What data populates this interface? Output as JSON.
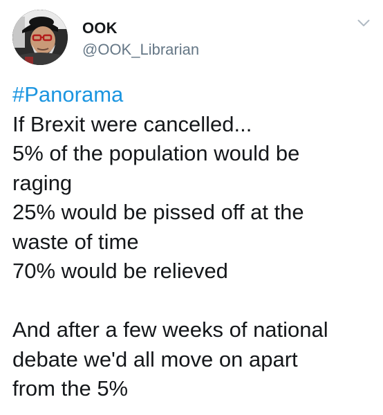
{
  "author": {
    "name": "OOK",
    "handle": "@OOK_Librarian"
  },
  "icons": {
    "more": "chevron-down-icon",
    "avatar": "avatar"
  },
  "tweet": {
    "hashtag": "#Panorama",
    "lines": [
      "If Brexit were cancelled...",
      "5% of the population would be",
      "raging",
      "25% would be pissed off at the",
      "waste of time",
      "70% would be relieved"
    ],
    "closing_lines": [
      "And after a few weeks of national",
      "debate we'd all move on apart",
      "from the 5%"
    ]
  },
  "colors": {
    "hashtag": "#1b95e0",
    "handle": "#657786",
    "text": "#14171a"
  }
}
